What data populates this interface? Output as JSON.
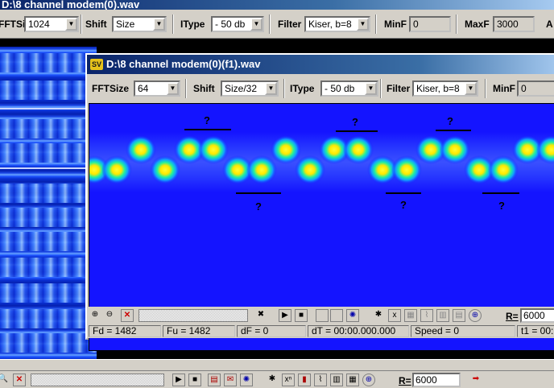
{
  "back_window": {
    "title": "D:\\8 channel modem(0).wav",
    "toolbar": {
      "fftsize_label": "FFTSize",
      "fftsize_value": "1024",
      "shift_label": "Shift",
      "shift_value": "Size",
      "itype_label": "IType",
      "itype_value": "- 50 db",
      "filter_label": "Filter",
      "filter_value": "Kiser, b=8",
      "minf_label": "MinF",
      "minf_value": "0",
      "maxf_label": "MaxF",
      "maxf_value": "3000",
      "extra_label": "A"
    },
    "bottom": {
      "rate_label": "R=",
      "rate_value": "6000"
    }
  },
  "front_window": {
    "title": "D:\\8 channel modem(0)(f1).wav",
    "app_icon": "SV",
    "toolbar": {
      "fftsize_label": "FFTSize",
      "fftsize_value": "64",
      "shift_label": "Shift",
      "shift_value": "Size/32",
      "itype_label": "IType",
      "itype_value": "- 50 db",
      "filter_label": "Filter",
      "filter_value": "Kiser, b=8",
      "minf_label": "MinF",
      "minf_value": "0"
    },
    "annotations": [
      "?",
      "?",
      "?",
      "?",
      "?",
      "?"
    ],
    "controls": {
      "rate_label": "R=",
      "rate_value": "6000"
    },
    "status": {
      "fd": "Fd = 1482",
      "fu": "Fu = 1482",
      "df": "dF = 0",
      "dt": "dT = 00:00.000.000",
      "speed": "Speed = 0",
      "t1": "t1 = 00:"
    }
  },
  "colors": {
    "spectrogram_bg": "#1414ff",
    "peak_core": "#ffe800",
    "peak_mid": "#00ff80",
    "titlebar": "#0a246a"
  },
  "icons": [
    "zoom-in-icon",
    "zoom-out-icon",
    "delete-icon",
    "play-icon",
    "stop-icon",
    "marker-icon",
    "spectrum-icon",
    "filter-icon",
    "next-icon"
  ]
}
